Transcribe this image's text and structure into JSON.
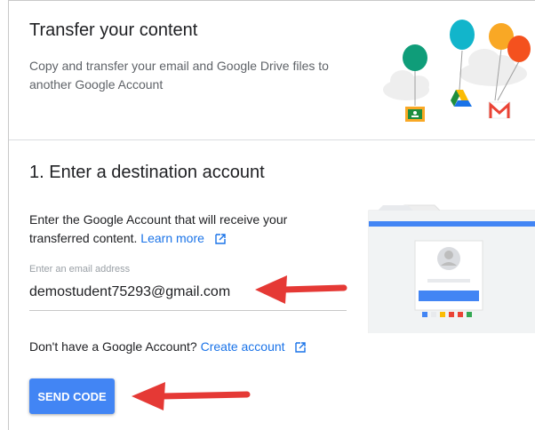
{
  "hero": {
    "title": "Transfer your content",
    "description": "Copy and transfer your email and Google Drive files to another Google Account"
  },
  "step": {
    "title": "1. Enter a destination account",
    "description": "Enter the Google Account that will receive your transferred content.",
    "learn_more_label": "Learn more"
  },
  "email_field": {
    "label": "Enter an email address",
    "value": "demostudent75293@gmail.com"
  },
  "no_account": {
    "text": "Don't have a Google Account?",
    "create_label": "Create account"
  },
  "send_button": {
    "label": "SEND CODE"
  },
  "colors": {
    "primary_blue": "#4285f4",
    "link_blue": "#1a73e8",
    "annotation_red": "#e53935",
    "balloon_teal": "#0f9d79",
    "balloon_cyan": "#12b5cb",
    "balloon_orange": "#f9a825",
    "balloon_red": "#f4511e"
  },
  "icons": {
    "classroom": "google-classroom-icon",
    "drive": "google-drive-icon",
    "gmail": "gmail-icon",
    "external_link": "external-link-icon"
  }
}
